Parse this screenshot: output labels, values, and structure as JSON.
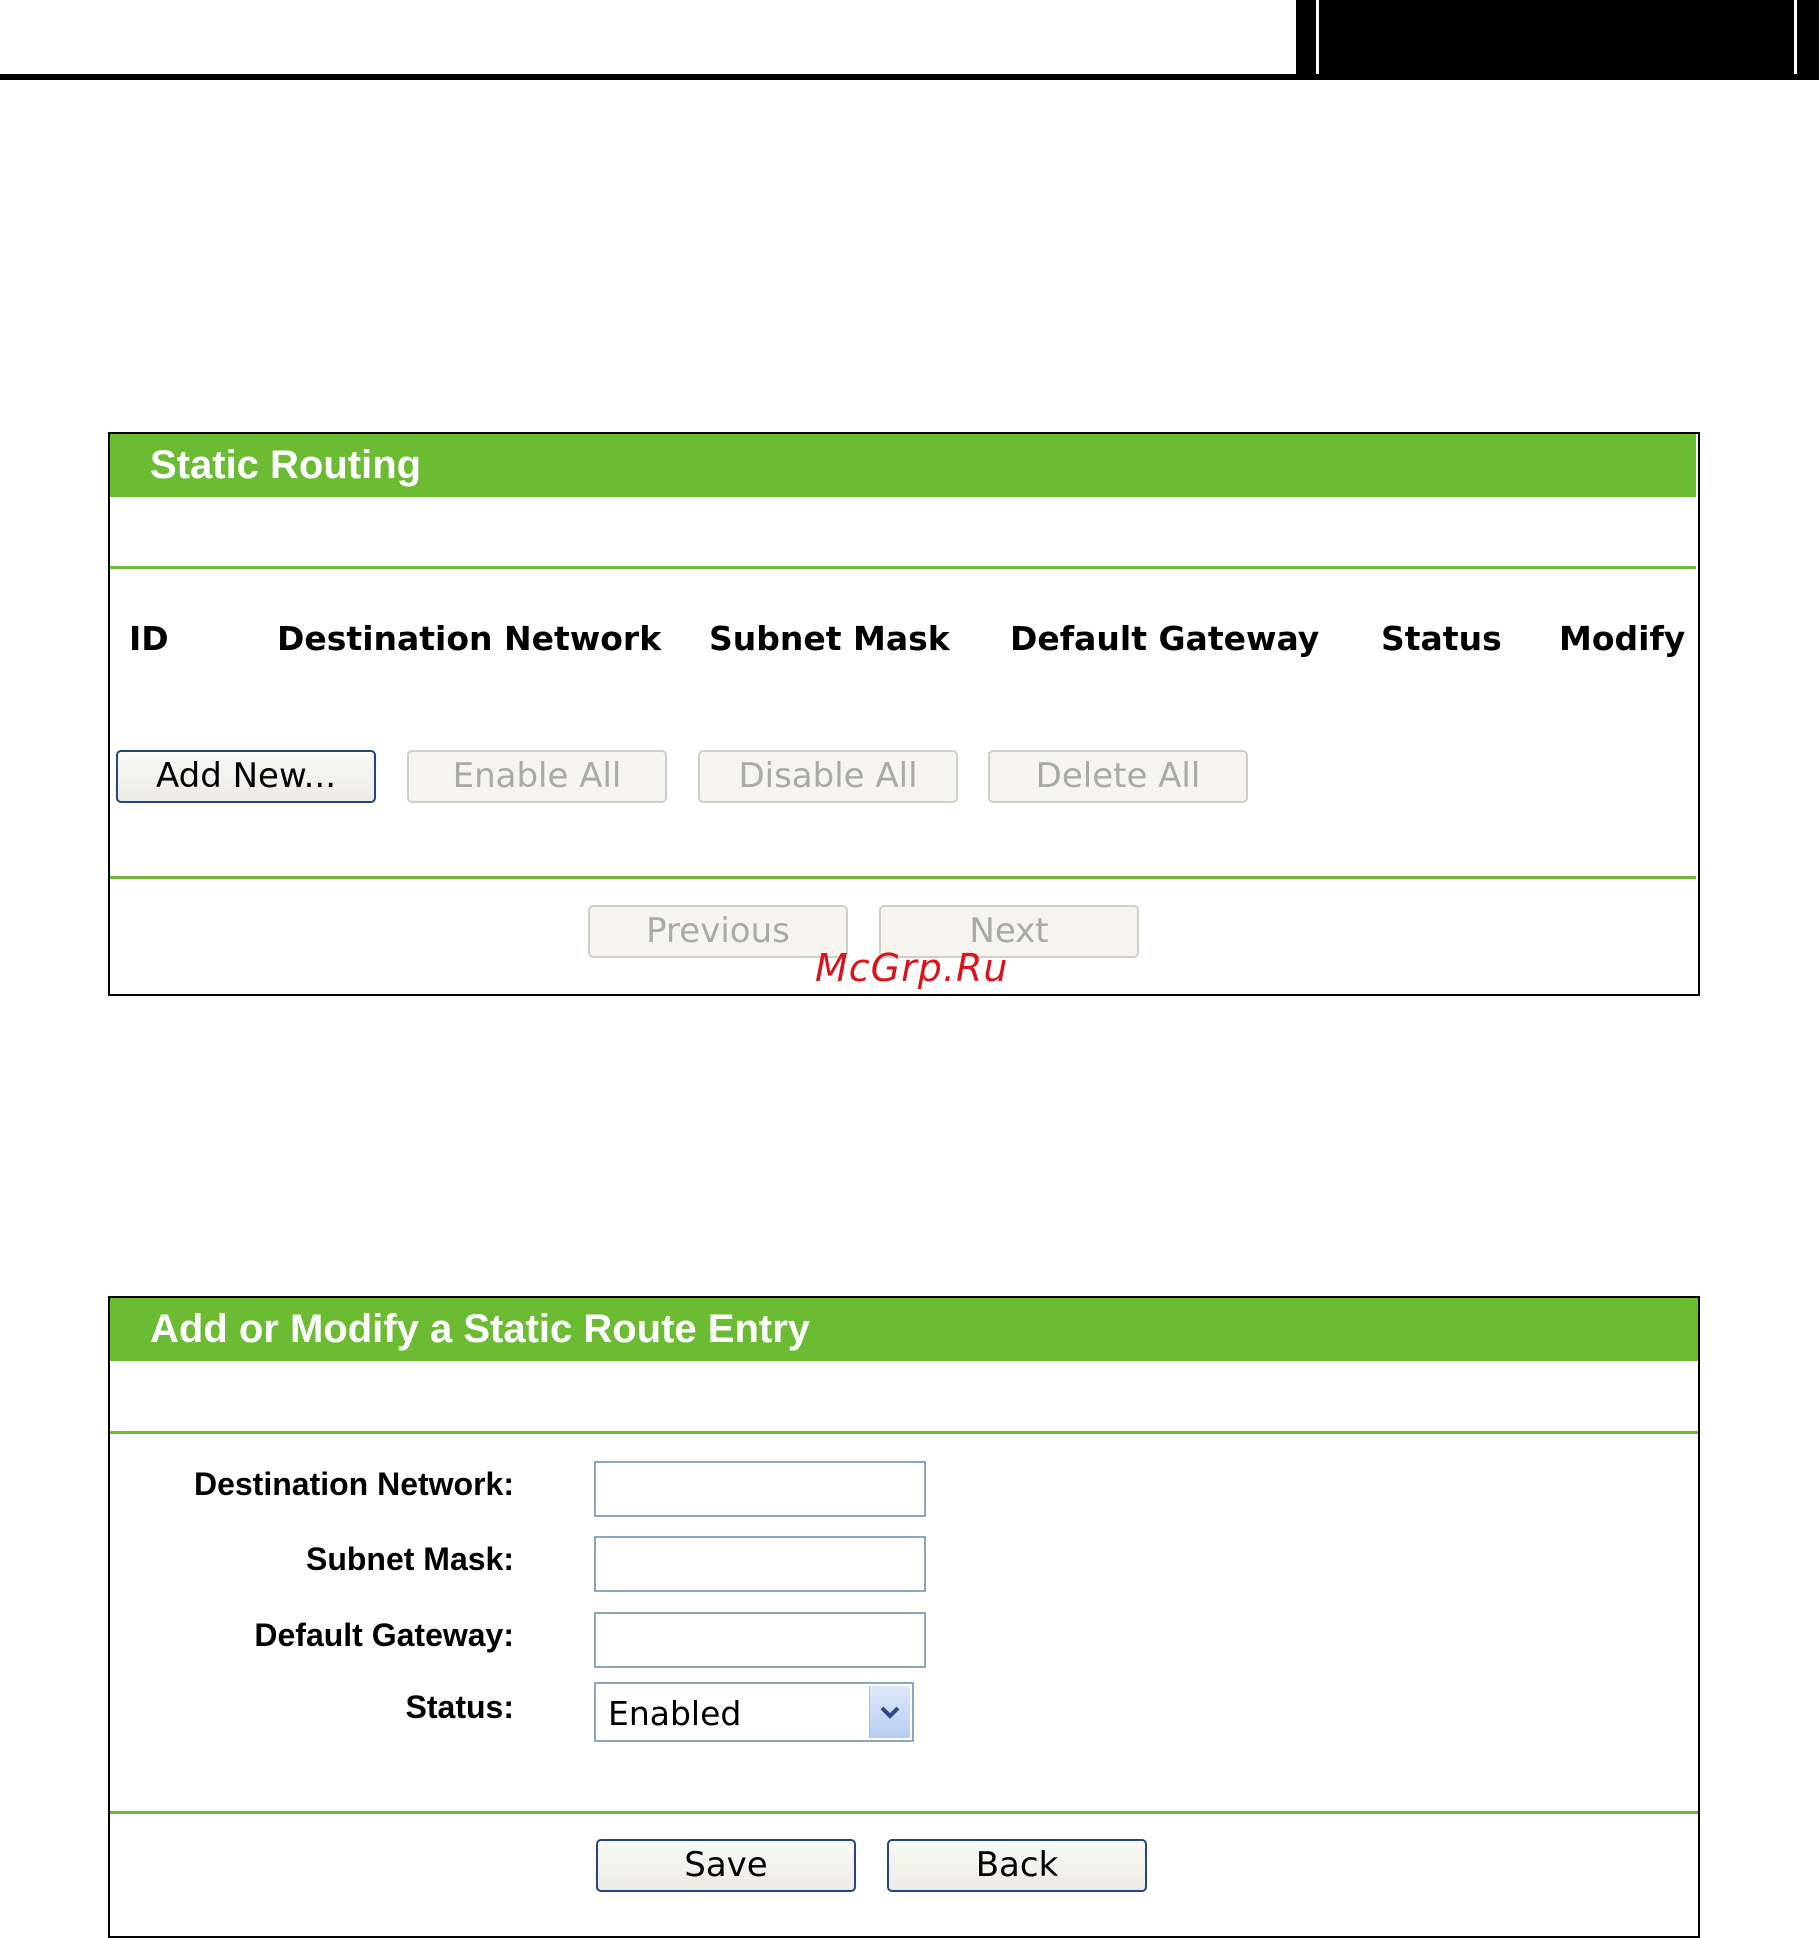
{
  "static_routing": {
    "title": "Static Routing",
    "columns": [
      "ID",
      "Destination Network",
      "Subnet Mask",
      "Default Gateway",
      "Status",
      "Modify"
    ],
    "buttons": {
      "add_new": "Add New...",
      "enable_all": "Enable All",
      "disable_all": "Disable All",
      "delete_all": "Delete All",
      "previous": "Previous",
      "next": "Next"
    }
  },
  "watermark": "McGrp.Ru",
  "entry_form": {
    "title": "Add or Modify a Static Route Entry",
    "destination_label": "Destination Network:",
    "destination_value": "",
    "subnet_label": "Subnet Mask:",
    "subnet_value": "",
    "gateway_label": "Default Gateway:",
    "gateway_value": "",
    "status_label": "Status:",
    "status_value": "Enabled",
    "save": "Save",
    "back": "Back"
  },
  "colors": {
    "accent": "#6bbb33",
    "button_border": "#24467a",
    "watermark": "#d9141c"
  }
}
